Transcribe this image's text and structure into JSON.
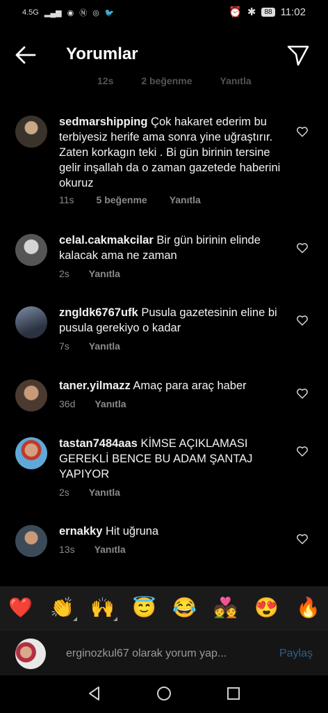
{
  "status": {
    "network": "4.5G",
    "time": "11:02",
    "battery": "88"
  },
  "header": {
    "title": "Yorumlar"
  },
  "peek": {
    "time": "12s",
    "likes": "2 beğenme",
    "reply": "Yanıtla"
  },
  "comments": [
    {
      "user": "sedmarshipping",
      "text": "Çok hakaret ederim bu terbiyesiz herife ama sonra yine uğraştırır. Zaten  korkagın teki . Bi gün birinin tersine gelir inşallah da o zaman gazetede haberini okuruz",
      "time": "11s",
      "likes": "5 beğenme",
      "reply": "Yanıtla"
    },
    {
      "user": "celal.cakmakcilar",
      "text": "Bir gün birinin elinde kalacak ama ne zaman",
      "time": "2s",
      "likes": "",
      "reply": "Yanıtla"
    },
    {
      "user": "zngldk6767ufk",
      "text": "Pusula gazetesinin eline bi pusula gerekiyo o kadar",
      "time": "7s",
      "likes": "",
      "reply": "Yanıtla"
    },
    {
      "user": "taner.yilmazz",
      "text": "Amaç para araç haber",
      "time": "36d",
      "likes": "",
      "reply": "Yanıtla"
    },
    {
      "user": "tastan7484aas",
      "text": "KİMSE AÇIKLAMASI GEREKLİ BENCE BU ADAM ŞANTAJ YAPIYOR",
      "time": "2s",
      "likes": "",
      "reply": "Yanıtla"
    },
    {
      "user": "ernakky",
      "text": "Hit uğruna",
      "time": "13s",
      "likes": "",
      "reply": "Yanıtla"
    }
  ],
  "reactions": [
    "❤️",
    "👏",
    "🙌",
    "😇",
    "😂",
    "💑",
    "😍",
    "🔥"
  ],
  "composer": {
    "placeholder": "erginozkul67 olarak yorum yap...",
    "share": "Paylaş"
  }
}
